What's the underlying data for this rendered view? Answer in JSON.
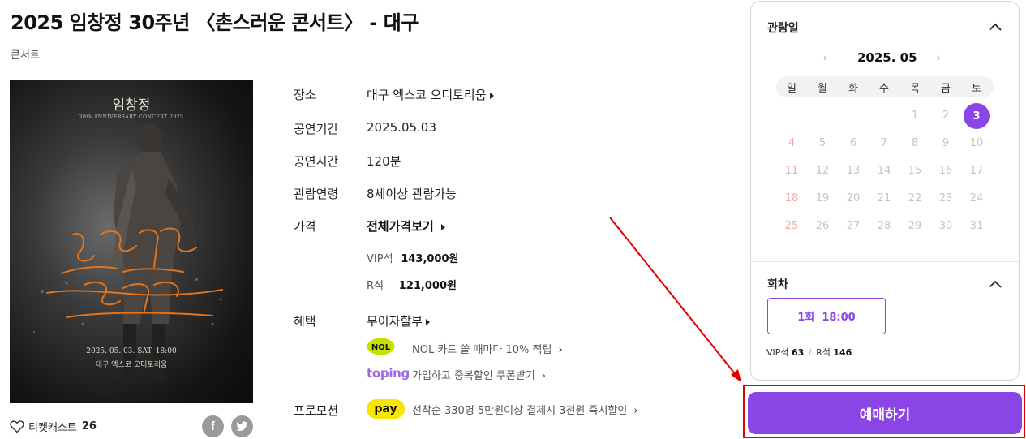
{
  "header": {
    "title": "2025 임창정 30주년 〈촌스러운 콘서트〉 - 대구",
    "genre": "콘서트"
  },
  "poster": {
    "artist_name": "임창정",
    "subtitle": "30th ANNIVERSARY CONCERT 2025",
    "date": "2025. 05. 03. SAT. 18:00",
    "venue": "대구 엑스코 오디토리움",
    "handwritten_title": "촌스러운 콘서트"
  },
  "footer": {
    "ticketcast_label": "티켓캐스트",
    "ticketcast_count": "26",
    "facebook_icon": "f",
    "twitter_icon": "twitter-bird"
  },
  "info": {
    "venue_label": "장소",
    "venue_value": "대구 엑스코 오디토리움",
    "period_label": "공연기간",
    "period_value": "2025.05.03",
    "runtime_label": "공연시간",
    "runtime_value": "120분",
    "age_label": "관람연령",
    "age_value": "8세이상 관람가능",
    "price_label": "가격",
    "price_all_link": "전체가격보기",
    "prices": [
      {
        "grade": "VIP석",
        "amount": "143,000원"
      },
      {
        "grade": "R석",
        "amount": "121,000원"
      }
    ],
    "benefit_label": "혜택",
    "benefit_link": "무이자할부",
    "nol_logo": "NOL",
    "nol_text": "NOL 카드 쓸 때마다 10% 적립",
    "toping_logo": "toping",
    "toping_text": "가입하고 중복할인 쿠폰받기",
    "promo_label": "프로모션",
    "pay_logo": "pay",
    "promo_text": "선착순 330명 5만원이상 결제시 3천원 즉시할인",
    "chevron": "›"
  },
  "calendar": {
    "section_title": "관람일",
    "month": "2025. 05",
    "prev": "‹",
    "next": "›",
    "weekdays": [
      "일",
      "월",
      "화",
      "수",
      "목",
      "금",
      "토"
    ],
    "rows": [
      [
        "",
        "",
        "",
        "",
        "1",
        "2",
        "3"
      ],
      [
        "4",
        "5",
        "6",
        "7",
        "8",
        "9",
        "10"
      ],
      [
        "11",
        "12",
        "13",
        "14",
        "15",
        "16",
        "17"
      ],
      [
        "18",
        "19",
        "20",
        "21",
        "22",
        "23",
        "24"
      ],
      [
        "25",
        "26",
        "27",
        "28",
        "29",
        "30",
        "31"
      ]
    ],
    "selected_day": "3",
    "accent": "#8b44e6"
  },
  "session": {
    "section_title": "회차",
    "button_label": "1회  18:00",
    "seats": [
      {
        "grade": "VIP석",
        "count": "63"
      },
      {
        "grade": "R석",
        "count": "146"
      }
    ],
    "seat_separator": "/"
  },
  "book_button": "예매하기",
  "annotation_color": "#e00000"
}
